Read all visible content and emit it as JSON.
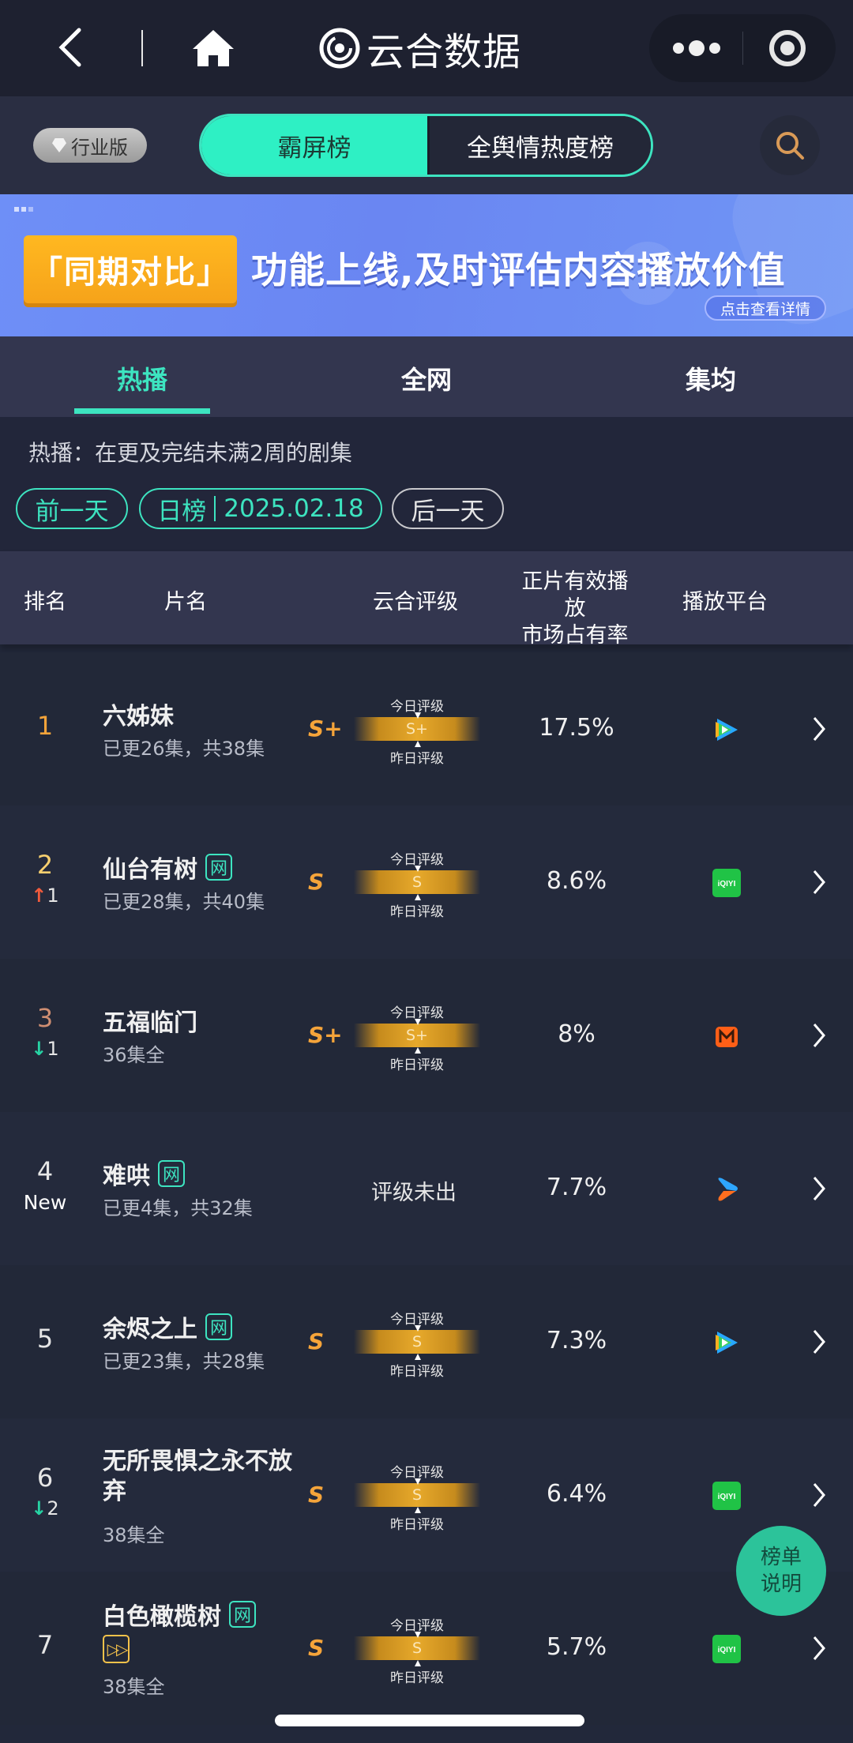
{
  "navbar": {
    "title": "云合数据",
    "icons": {
      "back": "chevron-left-icon",
      "home": "home-icon",
      "logo": "yunhe-logo-icon",
      "more": "more-dots-icon",
      "close": "target-circle-icon"
    }
  },
  "switchbar": {
    "edition_label": "行业版",
    "segments": [
      {
        "label": "霸屏榜",
        "active": true
      },
      {
        "label": "全舆情热度榜",
        "active": false
      }
    ],
    "search_icon": "search-icon"
  },
  "banner": {
    "tag": "「同期对比」",
    "headline": "功能上线,及时评估内容播放价值",
    "detail_button": "点击查看详情"
  },
  "tabs": [
    {
      "label": "热播",
      "active": true
    },
    {
      "label": "全网",
      "active": false
    },
    {
      "label": "集均",
      "active": false
    }
  ],
  "filters": {
    "description": "热播：在更及完结未满2周的剧集",
    "prev_day": "前一天",
    "chart_type": "日榜",
    "date": "2025.02.18",
    "next_day": "后一天"
  },
  "table": {
    "headers": {
      "rank": "排名",
      "name": "片名",
      "rating": "云合评级",
      "share_line1": "正片有效播放",
      "share_line2": "市场占有率",
      "platform": "播放平台"
    },
    "rating_labels": {
      "today": "今日评级",
      "yesterday": "昨日评级"
    },
    "rows": [
      {
        "rank": "1",
        "trend": "",
        "trend_value": "",
        "name": "六姊妹",
        "badges": [],
        "episodes": "已更26集，共38集",
        "grade": "S+",
        "meter_grade": "S+",
        "share": "17.5%",
        "platform": "腾讯视频"
      },
      {
        "rank": "2",
        "trend": "up",
        "trend_value": "1",
        "name": "仙台有树",
        "badges": [
          "网"
        ],
        "episodes": "已更28集，共40集",
        "grade": "S",
        "meter_grade": "S",
        "share": "8.6%",
        "platform": "爱奇艺"
      },
      {
        "rank": "3",
        "trend": "down",
        "trend_value": "1",
        "name": "五福临门",
        "badges": [],
        "episodes": "36集全",
        "grade": "S+",
        "meter_grade": "S+",
        "share": "8%",
        "platform": "芒果TV"
      },
      {
        "rank": "4",
        "trend": "new",
        "trend_value": "New",
        "name": "难哄",
        "badges": [
          "网"
        ],
        "episodes": "已更4集，共32集",
        "grade": "",
        "meter_grade": "",
        "no_rating": "评级未出",
        "share": "7.7%",
        "platform": "优酷"
      },
      {
        "rank": "5",
        "trend": "",
        "trend_value": "",
        "name": "余烬之上",
        "badges": [
          "网"
        ],
        "episodes": "已更23集，共28集",
        "grade": "S",
        "meter_grade": "S",
        "share": "7.3%",
        "platform": "腾讯视频"
      },
      {
        "rank": "6",
        "trend": "down",
        "trend_value": "2",
        "name": "无所畏惧之永不放弃",
        "badges": [],
        "episodes": "38集全",
        "grade": "S",
        "meter_grade": "S",
        "share": "6.4%",
        "platform": "爱奇艺"
      },
      {
        "rank": "7",
        "trend": "",
        "trend_value": "",
        "name": "白色橄榄树",
        "badges": [
          "网",
          "▷▷"
        ],
        "episodes": "38集全",
        "grade": "S",
        "meter_grade": "S",
        "share": "5.7%",
        "platform": "爱奇艺"
      }
    ]
  },
  "platforms": {
    "腾讯视频": {
      "icon": "tencent-video-icon",
      "colors": [
        "#27a8ff",
        "#ffb01f",
        "#33d15c"
      ]
    },
    "爱奇艺": {
      "icon": "iqiyi-icon",
      "label": "iQIYI",
      "color": "#20c346"
    },
    "芒果TV": {
      "icon": "mango-tv-icon",
      "color": "#ff5f17"
    },
    "优酷": {
      "icon": "youku-icon",
      "colors": [
        "#2ea6ff",
        "#ff6e1f"
      ]
    }
  },
  "help_button": {
    "line1": "榜单",
    "line2": "说明"
  },
  "colors": {
    "accent": "#3de4c0",
    "gold": "#f5a43a",
    "up": "#f15b3c",
    "down": "#27d3a4"
  }
}
